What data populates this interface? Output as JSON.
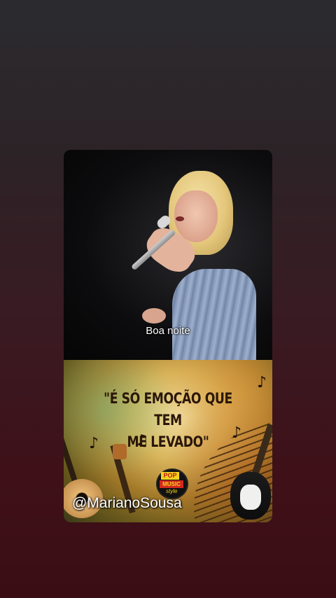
{
  "story": {
    "subtitle": "Boa noite",
    "poster": {
      "quote_line1": "\"É SÓ EMOÇÃO QUE TEM",
      "quote_line2": "ME LEVADO\"",
      "logo_line1": "POP",
      "logo_line2": "MUSIC",
      "logo_line3": "style",
      "handle": "@MarianoSousa"
    }
  },
  "icons": [
    "music-note-icon",
    "guitar-icon"
  ],
  "colors": {
    "background_top": "#2b2b2f",
    "background_bottom": "#3a0d14",
    "quote": "#2a1708"
  }
}
